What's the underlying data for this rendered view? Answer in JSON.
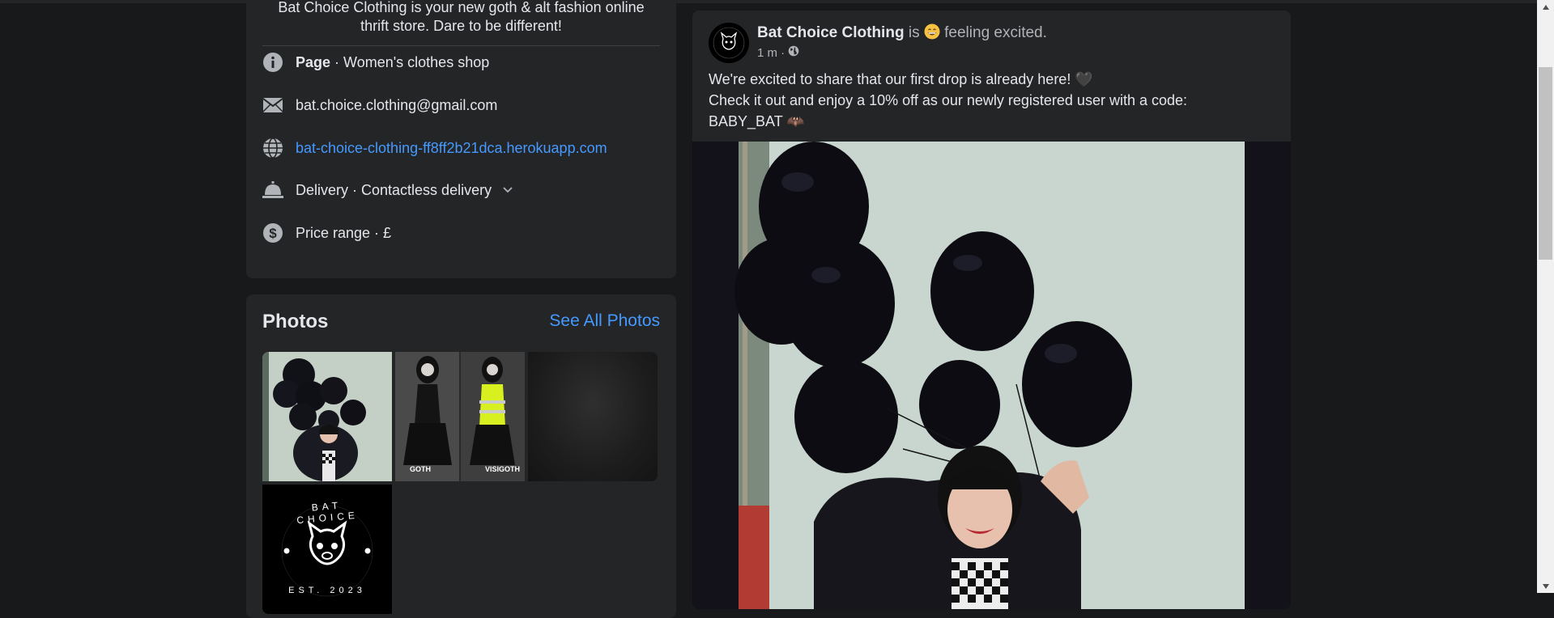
{
  "intro": {
    "bio_line1": "Bat Choice Clothing is your new goth & alt fashion online",
    "bio_line2": "thrift store. Dare to be different!",
    "page_label": "Page",
    "page_category": " · Women's clothes shop",
    "email": "bat.choice.clothing@gmail.com",
    "website": "bat-choice-clothing-ff8ff2b21dca.herokuapp.com",
    "delivery": "Delivery · Contactless delivery",
    "price_range": "Price range · £"
  },
  "photos": {
    "title": "Photos",
    "see_all": "See All Photos",
    "thumb_labels": [
      "GOTH",
      "VISIGOTH"
    ],
    "logo_text": "BAT CHOICE",
    "logo_est": "EST. 2023"
  },
  "post": {
    "author": "Bat Choice Clothing",
    "is": "is",
    "feeling": "feeling excited.",
    "time": "1 m ·",
    "line1": "We're excited to share that our first drop is already here! 🖤",
    "line2": "Check it out and enjoy a 10% off as our newly registered user with a code:",
    "line3": "BABY_BAT 🦇"
  },
  "colors": {
    "background": "#18191a",
    "card": "#242526",
    "link": "#4599ff",
    "muted": "#b0b3b8"
  },
  "icons": [
    "info-icon",
    "mail-icon",
    "globe-icon",
    "service-bell-icon",
    "dollar-icon",
    "chevron-down-icon",
    "public-globe-icon",
    "grinning-face-emoji"
  ]
}
